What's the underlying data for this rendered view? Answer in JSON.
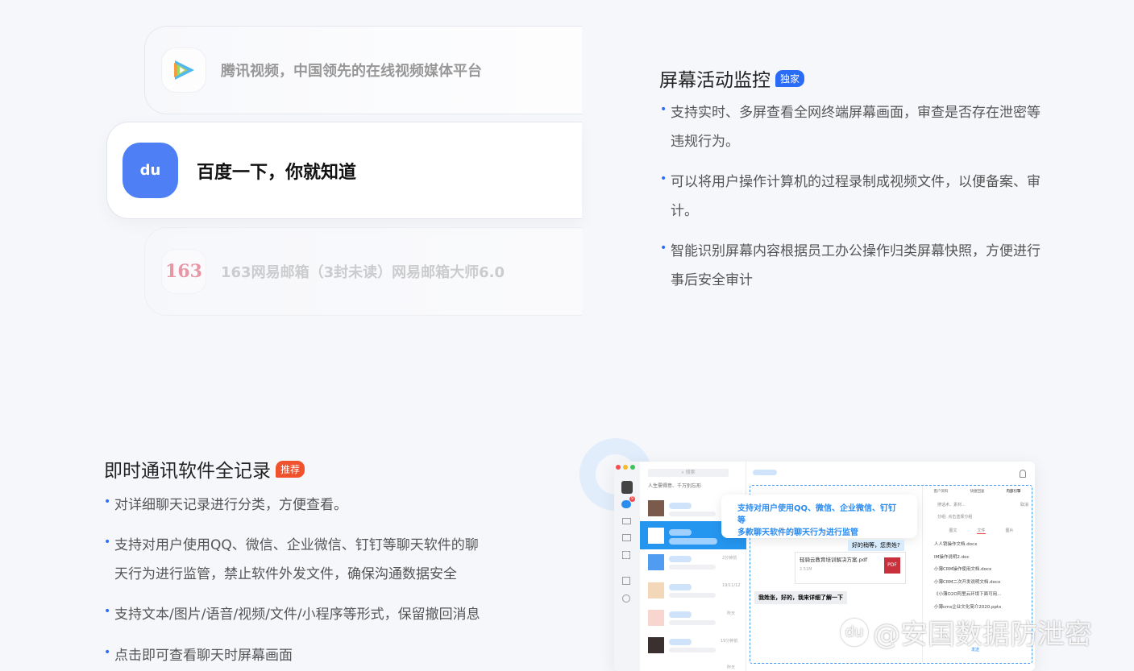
{
  "cards": [
    {
      "text": "腾讯视频，中国领先的在线视频媒体平台",
      "icon": "tencent-video-icon"
    },
    {
      "text": "百度一下，你就知道",
      "icon": "baidu-icon",
      "icon_text": "du"
    },
    {
      "text": "163网易邮箱（3封未读）网易邮箱大师6.0",
      "icon": "netease-163-icon",
      "icon_text": "163"
    }
  ],
  "screen": {
    "title": "屏幕活动监控",
    "badge": "独家",
    "badge_color": "#2b6cf6",
    "bullets": [
      [
        "支持实时、多屏查看全网终端屏幕画面，审查是否存在泄密等",
        "违规行为。"
      ],
      [
        "可以将用户操作计算机的过程录制成视频文件，以便备案、审",
        "计。"
      ],
      [
        "智能识别屏幕内容根据员工办公操作归类屏幕快照，方便进行",
        "事后安全审计"
      ]
    ]
  },
  "im": {
    "title": "即时通讯软件全记录",
    "badge": "推荐",
    "badge_color": "#f0522d",
    "bullets": [
      [
        "对详细聊天记录进行分类，方便查看。"
      ],
      [
        "支持对用户使用QQ、微信、企业微信、钉钉等聊天软件的聊",
        "天行为进行监管，禁止软件外发文件，确保沟通数据安全"
      ],
      [
        "支持文本/图片/语音/视频/文件/小程序等形式，保留撤回消息"
      ],
      [
        "点击即可查看聊天时屏幕画面"
      ]
    ]
  },
  "mock": {
    "search": "搜索",
    "group": "人生需得意、千万别忘形",
    "badge_count": "9",
    "callout": [
      "支持对用户使用QQ、微信、企业微信、钉钉等",
      "多款聊天软件的聊天行为进行监管"
    ],
    "times": [
      "",
      "",
      "2分钟前",
      "19/11/12",
      "昨天",
      "19分钟前",
      "昨天"
    ],
    "msg1": "好的稍等，您贵姓?",
    "file_name": "轻骑云教育培训解决方案.pdf",
    "file_size": "2.51M",
    "file_type": "PDF",
    "msg2": "我姓张，好的，我来详细了解一下",
    "rtabs": [
      "客户资料",
      "快捷回复",
      "内部引擎"
    ],
    "rsearch": "搜话术、素材...",
    "cancel": "取消",
    "group_label": "分组:",
    "group_hint": "点击选择分组",
    "ftabs": [
      "图文",
      "文件",
      "图片"
    ],
    "files": [
      "人人销操作文档.docx",
      "IM操作说明2.doc",
      "小薄CRM操作使用文档.docx",
      "小薄CRM二次开发说明文档.docx",
      "《小薄O2O阿里云环境下面可用...",
      "小薄cms企业文化简介2020.pptx"
    ],
    "send": "发送"
  },
  "watermark": "@安国数据防泄密"
}
